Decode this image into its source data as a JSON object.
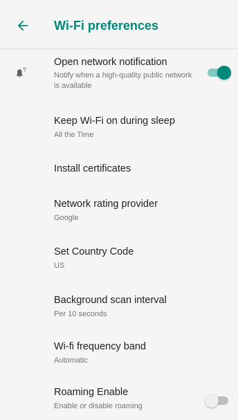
{
  "header": {
    "back_icon": "arrow-left-icon",
    "title": "Wi-Fi preferences",
    "accent_color": "#00897b"
  },
  "settings": [
    {
      "title": "Open network notification",
      "summary": "Notify when a high-quality public network is available",
      "icon": "wifi-notification-bell-icon",
      "toggle": true
    },
    {
      "title": "Keep Wi-Fi on during sleep",
      "summary": "All the Time"
    },
    {
      "title": "Install certificates"
    },
    {
      "title": "Network rating provider",
      "summary": "Google"
    },
    {
      "title": "Set Country Code",
      "summary": "US"
    },
    {
      "title": "Background scan interval",
      "summary": "Per 10 seconds"
    },
    {
      "title": "Wi-fi frequency band",
      "summary": "Automatic"
    },
    {
      "title": "Roaming Enable",
      "summary": "Enable or disable roaming",
      "toggle": false
    }
  ]
}
